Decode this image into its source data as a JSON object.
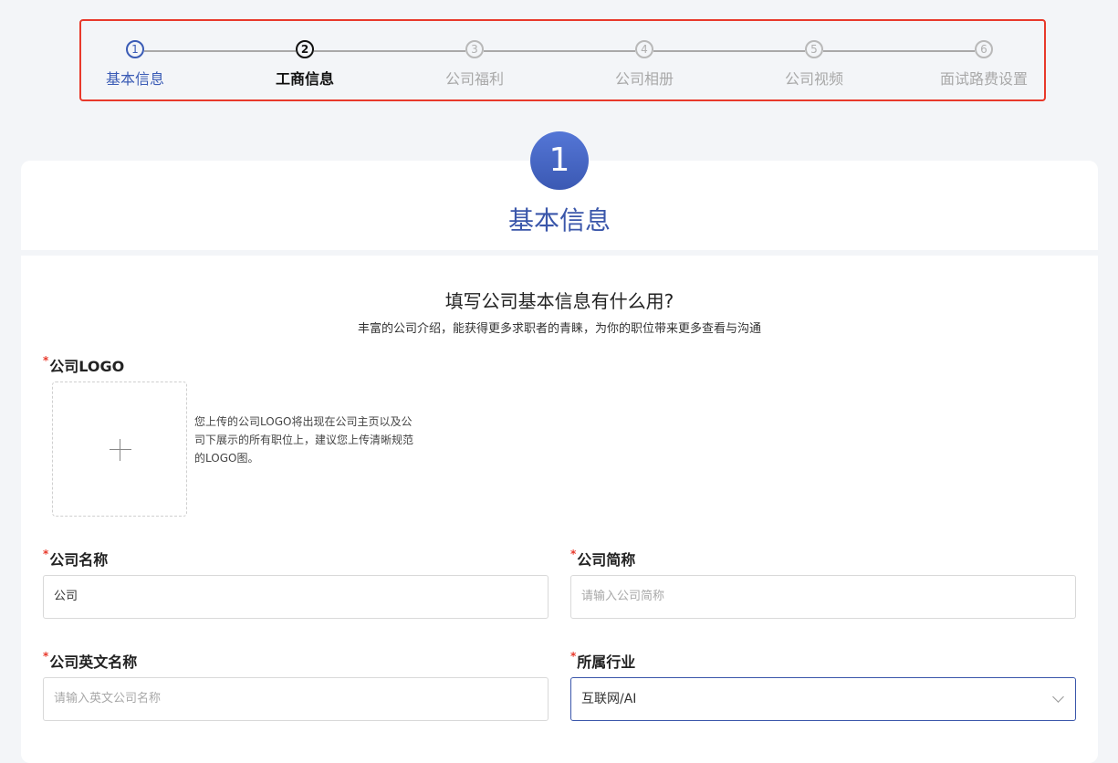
{
  "steps": [
    {
      "num": "1",
      "label": "基本信息",
      "state": "done"
    },
    {
      "num": "2",
      "label": "工商信息",
      "state": "active"
    },
    {
      "num": "3",
      "label": "公司福利",
      "state": "todo"
    },
    {
      "num": "4",
      "label": "公司相册",
      "state": "todo"
    },
    {
      "num": "5",
      "label": "公司视频",
      "state": "todo"
    },
    {
      "num": "6",
      "label": "面试路费设置",
      "state": "todo"
    }
  ],
  "section": {
    "badge": "1",
    "title": "基本信息"
  },
  "intro": {
    "title": "填写公司基本信息有什么用?",
    "subtitle": "丰富的公司介绍，能获得更多求职者的青睐，为你的职位带来更多查看与沟通"
  },
  "logo": {
    "label": "公司LOGO",
    "hint": "您上传的公司LOGO将出现在公司主页以及公司下展示的所有职位上，建议您上传清晰规范的LOGO图。"
  },
  "fields": {
    "company_name": {
      "label": "公司名称",
      "value": "公司"
    },
    "short_name": {
      "label": "公司简称",
      "placeholder": "请输入公司简称"
    },
    "english_name": {
      "label": "公司英文名称",
      "placeholder": "请输入英文公司名称"
    },
    "industry": {
      "label": "所属行业",
      "value": "互联网/AI"
    }
  },
  "required_mark": "*",
  "colors": {
    "accent": "#3a56aa",
    "highlight_border": "#e8392b",
    "required": "#e8392b"
  }
}
